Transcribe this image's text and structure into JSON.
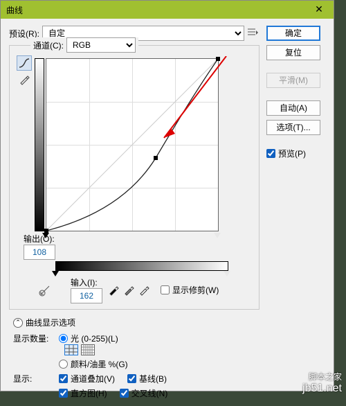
{
  "window": {
    "title": "曲线",
    "close": "✕"
  },
  "preset": {
    "label": "预设(R):",
    "value": "自定"
  },
  "channel": {
    "label": "通道(C):",
    "value": "RGB"
  },
  "buttons": {
    "ok": "确定",
    "reset": "复位",
    "smooth": "平滑(M)",
    "auto": "自动(A)",
    "options": "选项(T)..."
  },
  "preview": {
    "label": "预览(P)"
  },
  "output": {
    "label": "输出(O):",
    "value": "108"
  },
  "input": {
    "label": "输入(I):",
    "value": "162"
  },
  "show_clip": {
    "label": "显示修剪(W)"
  },
  "curve_options": {
    "label": "曲线显示选项",
    "expand": "ˇ"
  },
  "amount": {
    "label": "显示数量:",
    "light": "光 (0-255)(L)",
    "pigment": "颜料/油墨 %(G)"
  },
  "show": {
    "label": "显示:",
    "overlay": "通道叠加(V)",
    "baseline": "基线(B)",
    "histogram": "直方图(H)",
    "intersection": "交叉线(N)"
  },
  "chart_data": {
    "type": "curve",
    "xlabel": "输入",
    "ylabel": "输出",
    "xlim": [
      0,
      255
    ],
    "ylim": [
      0,
      255
    ],
    "points": [
      {
        "x": 0,
        "y": 0
      },
      {
        "x": 162,
        "y": 108
      },
      {
        "x": 255,
        "y": 255
      }
    ],
    "grid": "4x4",
    "baseline": true
  },
  "watermark": {
    "site": "jb51.net",
    "name": "脚本之家"
  }
}
